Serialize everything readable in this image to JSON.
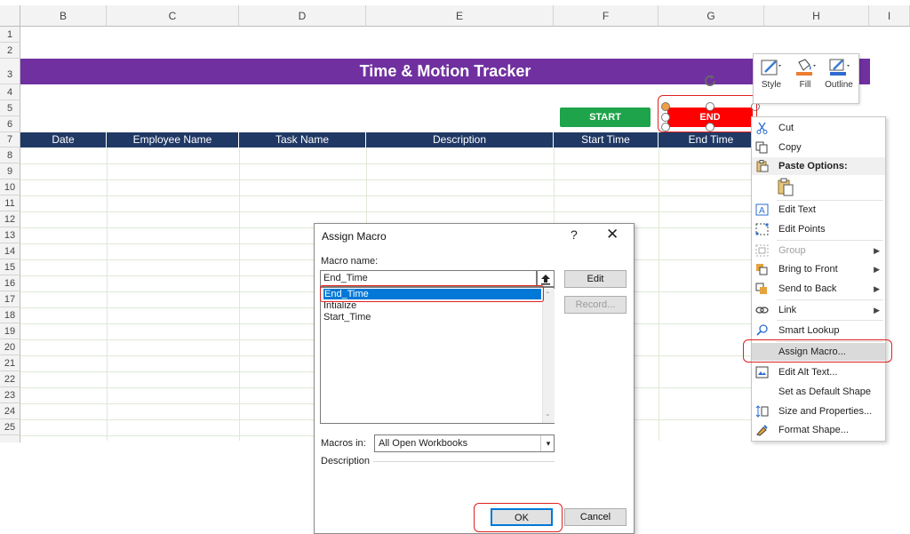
{
  "sheet": {
    "columns": [
      "B",
      "C",
      "D",
      "E",
      "F",
      "G",
      "H",
      "I"
    ],
    "rows": [
      "1",
      "2",
      "3",
      "4",
      "5",
      "6",
      "7",
      "8",
      "9",
      "10",
      "11",
      "12",
      "13",
      "14",
      "15",
      "16",
      "17",
      "18",
      "19",
      "20",
      "21",
      "22",
      "23",
      "24",
      "25"
    ],
    "title": "Time & Motion Tracker",
    "table_headers": [
      "Date",
      "Employee Name",
      "Task Name",
      "Description",
      "Start Time",
      "End Time"
    ],
    "start_button": "START",
    "end_button": "END",
    "colors": {
      "title_bg": "#7030a0",
      "header_bg": "#203864",
      "start_bg": "#1ea44a",
      "end_bg": "#ff0000",
      "highlight": "#e02020"
    }
  },
  "mini_toolbar": {
    "style": "Style",
    "fill": "Fill",
    "outline": "Outline"
  },
  "context_menu": {
    "cut": "Cut",
    "copy": "Copy",
    "paste_options": "Paste Options:",
    "edit_text": "Edit Text",
    "edit_points": "Edit Points",
    "group": "Group",
    "bring_to_front": "Bring to Front",
    "send_to_back": "Send to Back",
    "link": "Link",
    "smart_lookup": "Smart Lookup",
    "assign_macro": "Assign Macro...",
    "edit_alt_text": "Edit Alt Text...",
    "set_default_shape": "Set as Default Shape",
    "size_and_properties": "Size and Properties...",
    "format_shape": "Format Shape..."
  },
  "dialog": {
    "title": "Assign Macro",
    "help": "?",
    "close": "✕",
    "macro_name_label": "Macro name:",
    "macro_name_value": "End_Time",
    "macros": [
      "End_Time",
      "Intialize",
      "Start_Time"
    ],
    "selected_macro": "End_Time",
    "edit_button": "Edit",
    "record_button": "Record...",
    "macros_in_label": "Macros in:",
    "macros_in_value": "All Open Workbooks",
    "description_label": "Description",
    "ok_button": "OK",
    "cancel_button": "Cancel"
  }
}
